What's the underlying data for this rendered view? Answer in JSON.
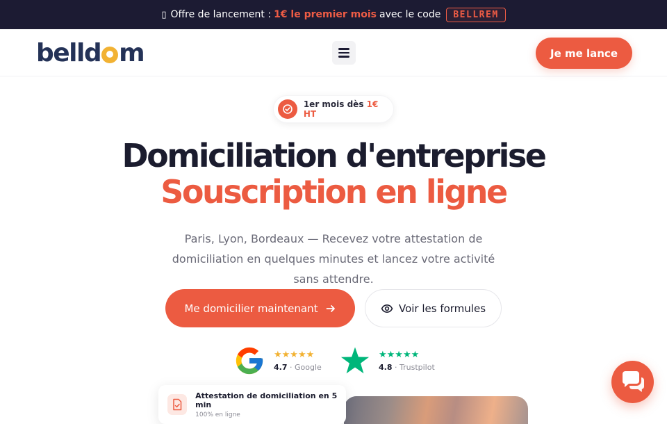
{
  "promo": {
    "gift_icon": "gift-icon",
    "gift_glyph": "▯",
    "prefix": "Offre de lancement :",
    "highlight": "1€ le premier mois",
    "middle": "avec le code",
    "code": "BELLREM"
  },
  "header": {
    "logo_left": "belld",
    "logo_right": "m",
    "menu_icon": "hamburger-menu-icon",
    "cta_label": "Je me lance"
  },
  "offer_pill": {
    "icon": "check-circle-icon",
    "text": "1er mois dès",
    "price": "1€ HT"
  },
  "hero": {
    "title_main": "Domiciliation d'entreprise",
    "title_accent": "Souscription en ligne",
    "subtitle": "Paris, Lyon, Bordeaux — Recevez votre attestation de domiciliation en quelques minutes et lancez votre activité sans attendre.",
    "primary_button": "Me domicilier maintenant",
    "secondary_button": "Voir les formules"
  },
  "ratings": {
    "google": {
      "score": "4.7",
      "source": "Google",
      "stars": "★★★★★",
      "icon": "google-g-icon"
    },
    "trustpilot": {
      "score": "4.8",
      "source": "Trustpilot",
      "stars": "★★★★★",
      "icon": "trustpilot-star-icon"
    }
  },
  "attestation_card": {
    "icon": "document-icon",
    "title": "Attestation de domiciliation en 5 min",
    "subtitle": "100% en ligne"
  },
  "chat": {
    "icon": "chat-bubbles-icon"
  },
  "colors": {
    "accent": "#ec5b41",
    "navy": "#1c1b33",
    "logo_blue": "#243257",
    "logo_yellow": "#f2b233",
    "trustpilot_green": "#00b67a"
  }
}
